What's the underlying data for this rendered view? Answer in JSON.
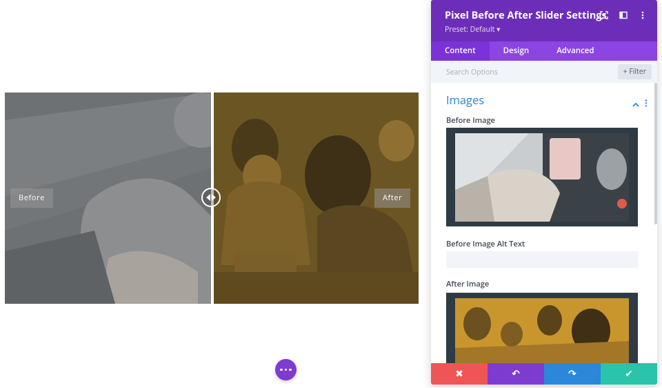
{
  "slider": {
    "before_label": "Before",
    "after_label": "After",
    "before_tint": "#6b6d70",
    "after_tint": "#6b5522"
  },
  "fab": {
    "icon": "more-dots-icon",
    "color": "#7e3bd0"
  },
  "panel": {
    "title": "Pixel Before After Slider Settings",
    "preset": "Preset: Default ▾",
    "header_icons": [
      "expand-icon",
      "sidebar-toggle-icon",
      "more-vertical-icon"
    ],
    "header_color": "#6c2eb9",
    "tabs": [
      {
        "label": "Content",
        "active": true
      },
      {
        "label": "Design",
        "active": false
      },
      {
        "label": "Advanced",
        "active": false
      }
    ],
    "search_placeholder": "Search Options",
    "filter_label": "+ Filter",
    "section_title": "Images",
    "before_image_label": "Before Image",
    "before_alt_label": "Before Image Alt Text",
    "before_alt_value": "",
    "after_image_label": "After Image",
    "bottom_actions": [
      {
        "name": "cancel",
        "icon": "close-icon",
        "glyph": "✖",
        "color": "#ef5555"
      },
      {
        "name": "undo",
        "icon": "undo-icon",
        "glyph": "↶",
        "color": "#7e3bd0"
      },
      {
        "name": "redo",
        "icon": "redo-icon",
        "glyph": "↷",
        "color": "#2b87da"
      },
      {
        "name": "save",
        "icon": "check-icon",
        "glyph": "✔",
        "color": "#29c4a9"
      }
    ]
  }
}
